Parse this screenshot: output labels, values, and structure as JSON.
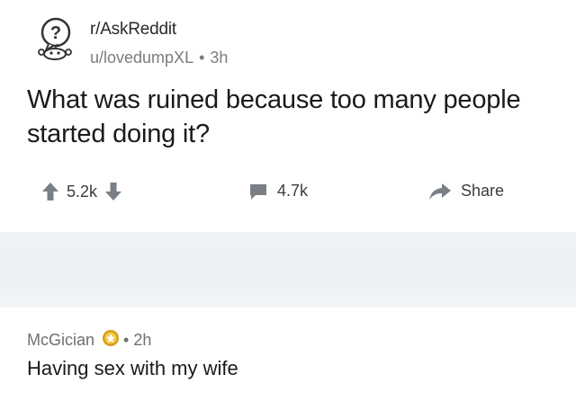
{
  "post": {
    "subreddit": "r/AskReddit",
    "author": "u/lovedumpXL",
    "separator": "•",
    "age": "3h",
    "title": "What was ruined because too many people started doing it?",
    "upvotes": "5.2k",
    "comments": "4.7k",
    "share_label": "Share"
  },
  "comment": {
    "author": "McGician",
    "separator": "•",
    "age": "2h",
    "body": "Having sex with my wife"
  },
  "colors": {
    "icon": "#7a7f85",
    "award": "#d4a017",
    "meta": "#7c7c7c"
  },
  "icons": [
    "askreddit-logo-icon",
    "upvote-icon",
    "downvote-icon",
    "comment-icon",
    "share-icon",
    "award-icon"
  ]
}
